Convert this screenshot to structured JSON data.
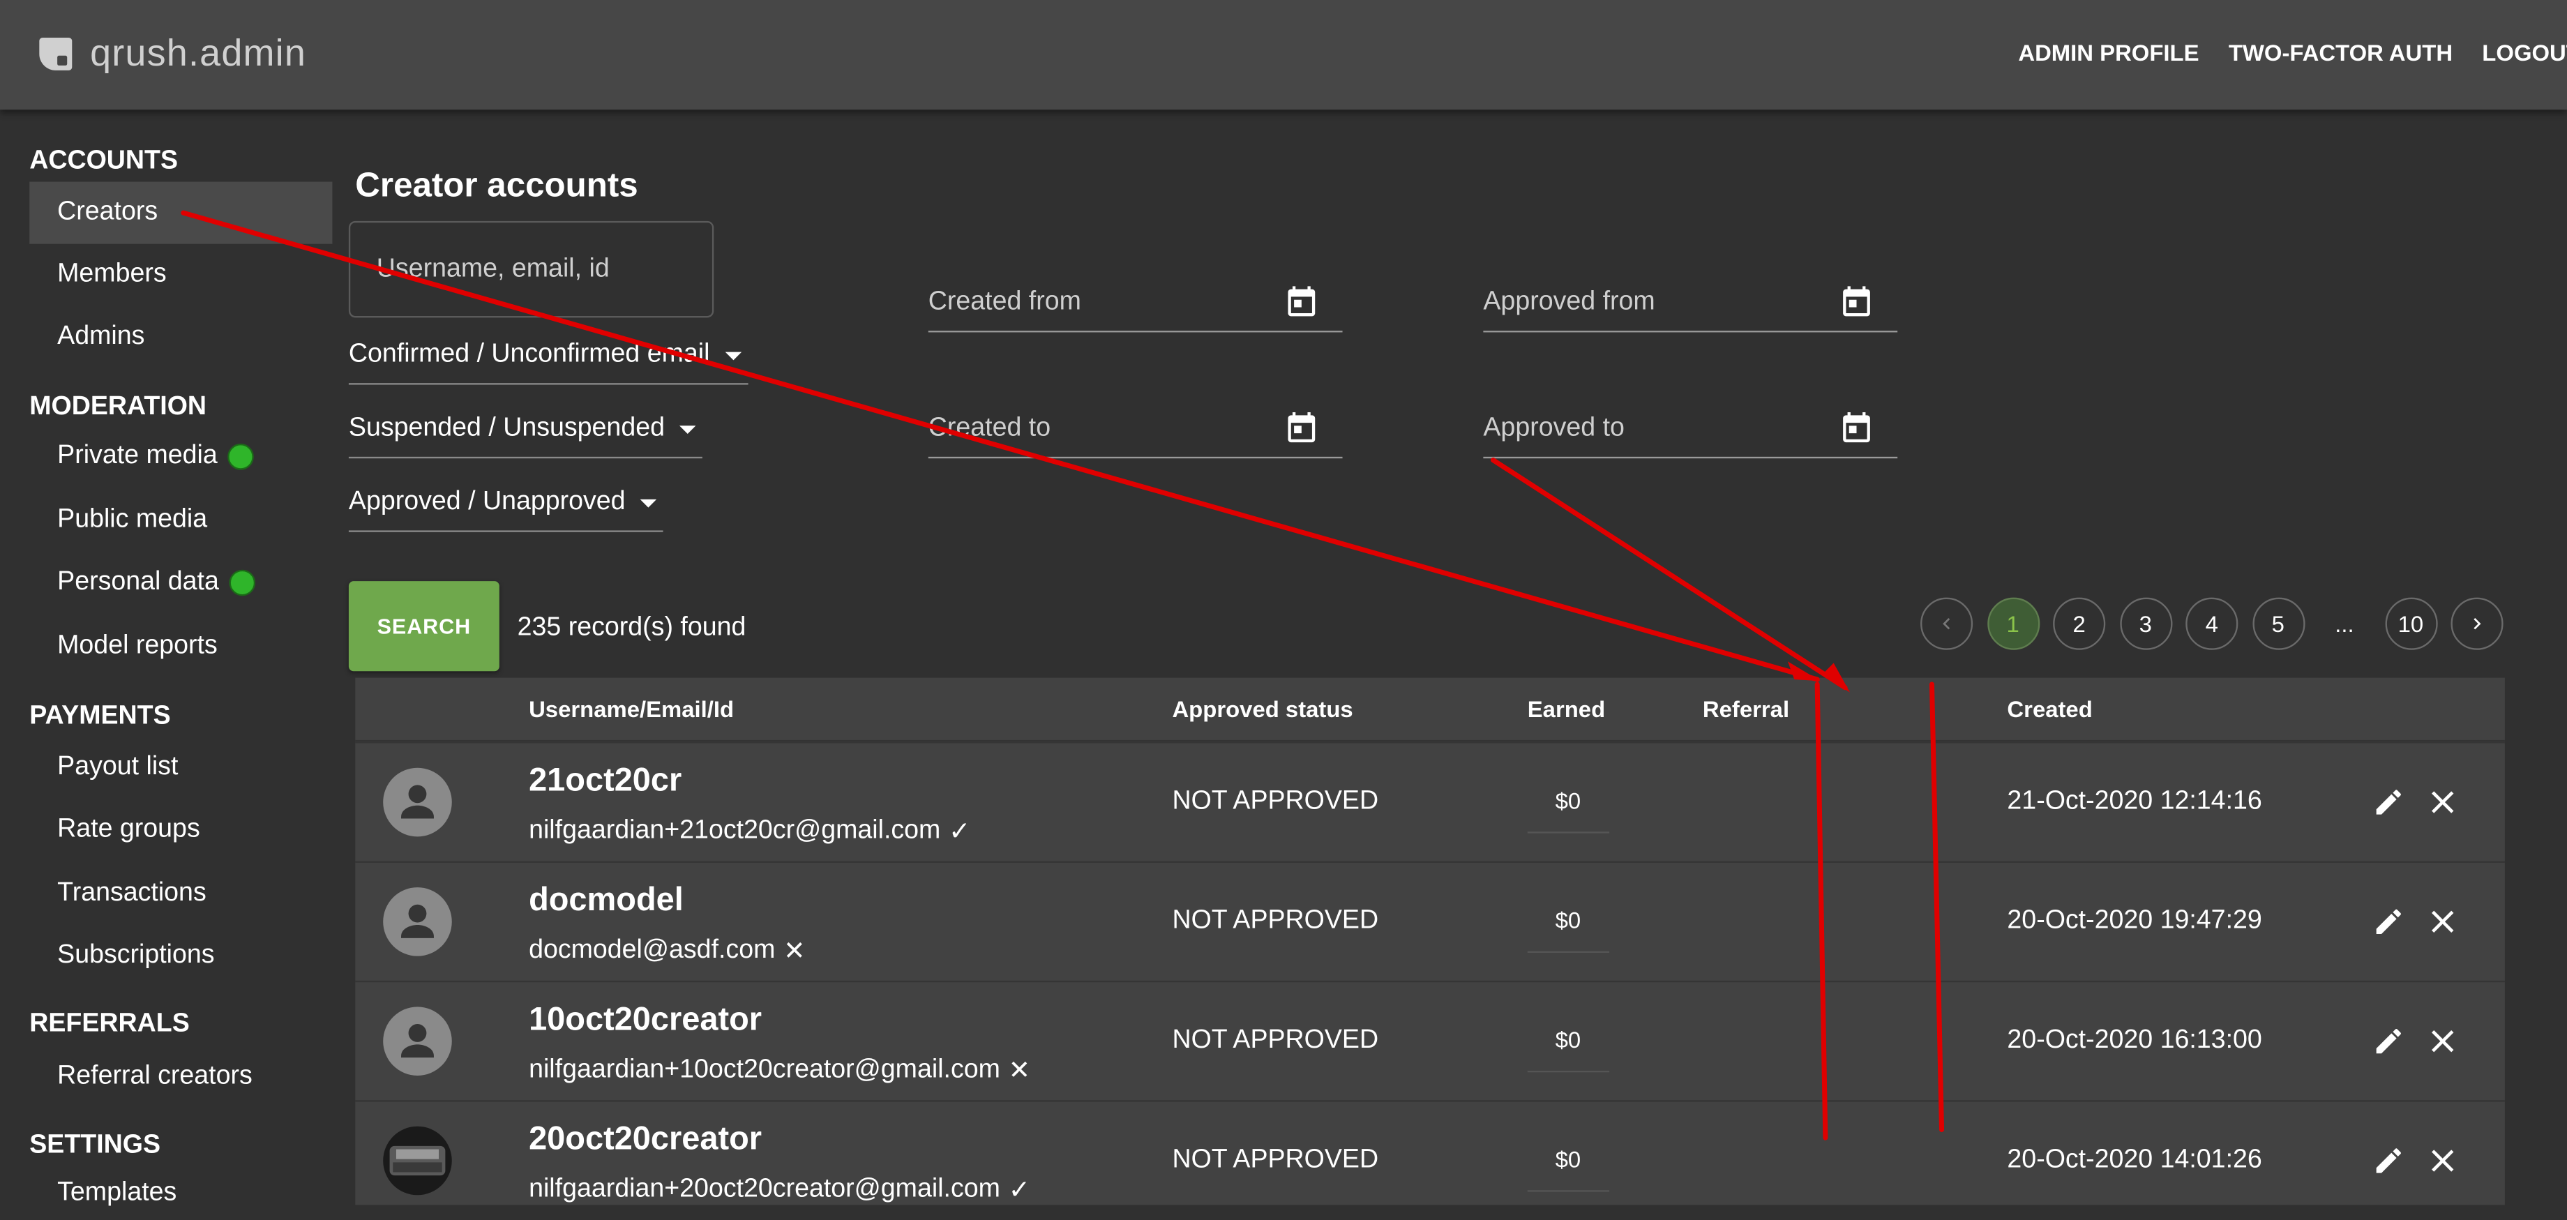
{
  "app": {
    "title": "qrush.admin"
  },
  "topnav": [
    "ADMIN PROFILE",
    "TWO-FACTOR AUTH",
    "LOGOUT"
  ],
  "sidebar": {
    "sections": [
      {
        "title": "ACCOUNTS",
        "items": [
          "Creators",
          "Members",
          "Admins"
        ]
      },
      {
        "title": "MODERATION",
        "items": [
          "Private media",
          "Public media",
          "Personal data",
          "Model reports"
        ]
      },
      {
        "title": "PAYMENTS",
        "items": [
          "Payout list",
          "Rate groups",
          "Transactions",
          "Subscriptions"
        ]
      },
      {
        "title": "REFERRALS",
        "items": [
          "Referral creators"
        ]
      },
      {
        "title": "SETTINGS",
        "items": [
          "Templates"
        ]
      }
    ],
    "active_item": "Creators",
    "status_dot_color": "#2fb52a"
  },
  "page": {
    "title": "Creator accounts"
  },
  "filters": {
    "search_placeholder": "Username, email, id",
    "email_select": "Confirmed / Unconfirmed email",
    "suspended_select": "Suspended / Unsuspended",
    "approved_select": "Approved / Unapproved",
    "created_from": "Created from",
    "created_to": "Created to",
    "approved_from": "Approved from",
    "approved_to": "Approved to"
  },
  "search_button": "SEARCH",
  "records_text": "235 record(s) found",
  "pagination": {
    "pages": [
      "1",
      "2",
      "3",
      "4",
      "5",
      "...",
      "10"
    ],
    "current": "1"
  },
  "table": {
    "headers": {
      "username": "Username/Email/Id",
      "approved": "Approved status",
      "earned": "Earned",
      "referral": "Referral",
      "created": "Created"
    },
    "rows": [
      {
        "username": "21oct20cr",
        "email": "nilfgaardian+21oct20cr@gmail.com",
        "email_mark": "✓",
        "status": "NOT APPROVED",
        "earned": "$0",
        "created": "21-Oct-2020 12:14:16"
      },
      {
        "username": "docmodel",
        "email": "docmodel@asdf.com",
        "email_mark": "✕",
        "status": "NOT APPROVED",
        "earned": "$0",
        "created": "20-Oct-2020 19:47:29"
      },
      {
        "username": "10oct20creator",
        "email": "nilfgaardian+10oct20creator@gmail.com",
        "email_mark": "✕",
        "status": "NOT APPROVED",
        "earned": "$0",
        "created": "20-Oct-2020 16:13:00"
      },
      {
        "username": "20oct20creator",
        "email": "nilfgaardian+20oct20creator@gmail.com",
        "email_mark": "✓",
        "status": "NOT APPROVED",
        "earned": "$0",
        "created": "20-Oct-2020 14:01:26"
      }
    ]
  },
  "colors": {
    "accent": "#6fa84c",
    "annotation": "#e00000"
  }
}
